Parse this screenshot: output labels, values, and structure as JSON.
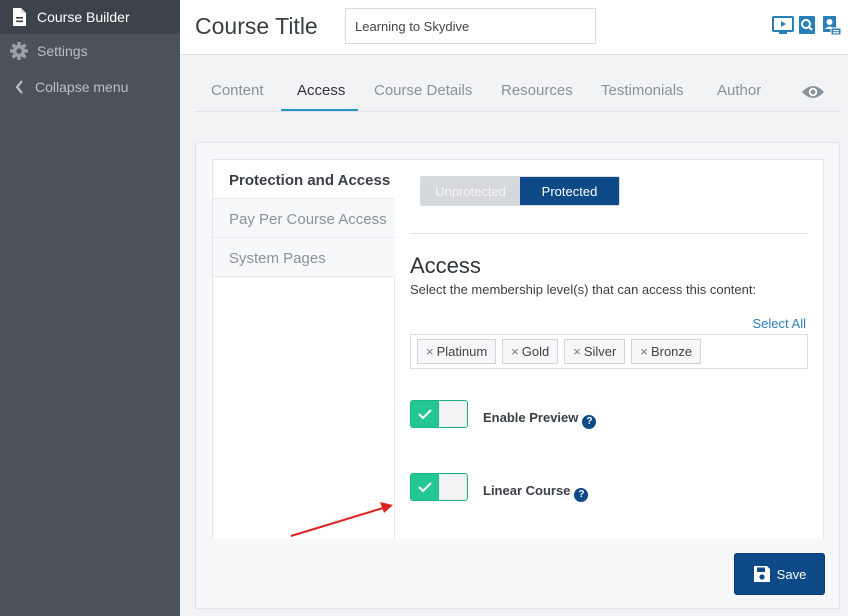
{
  "sidebar": {
    "items": [
      {
        "label": "Course Builder",
        "icon": "document-icon",
        "active": true
      },
      {
        "label": "Settings",
        "icon": "gear-icon",
        "active": false
      },
      {
        "label": "Collapse menu",
        "icon": "chevron-left-icon",
        "active": false
      }
    ]
  },
  "header": {
    "title": "Course Title",
    "course_name_value": "Learning to Skydive",
    "icons": [
      "preview-screen-icon",
      "search-page-icon",
      "user-profile-icon"
    ]
  },
  "tabs": [
    {
      "label": "Content",
      "active": false
    },
    {
      "label": "Access",
      "active": true
    },
    {
      "label": "Course Details",
      "active": false
    },
    {
      "label": "Resources",
      "active": false
    },
    {
      "label": "Testimonials",
      "active": false
    },
    {
      "label": "Author",
      "active": false
    }
  ],
  "subnav": [
    {
      "label": "Protection and Access",
      "active": true
    },
    {
      "label": "Pay Per Course Access",
      "active": false
    },
    {
      "label": "System Pages",
      "active": false
    }
  ],
  "protection": {
    "options": [
      "Unprotected",
      "Protected"
    ],
    "selected": "Protected"
  },
  "access": {
    "heading": "Access",
    "description": "Select the membership level(s) that can access this content:",
    "select_all": "Select All",
    "levels": [
      {
        "label": "Platinum",
        "remove": "×"
      },
      {
        "label": "Gold",
        "remove": "×"
      },
      {
        "label": "Silver",
        "remove": "×"
      },
      {
        "label": "Bronze",
        "remove": "×"
      }
    ]
  },
  "options": {
    "enable_preview": {
      "label": "Enable Preview",
      "on": true,
      "help": "?"
    },
    "linear_course": {
      "label": "Linear Course",
      "on": true,
      "help": "?"
    }
  },
  "save_label": "Save",
  "colors": {
    "sidebar_bg": "#4a525a",
    "primary": "#0d4a87",
    "toggle_green": "#24c793",
    "tab_underline": "#2a93c7",
    "arrow": "#e0221e"
  }
}
